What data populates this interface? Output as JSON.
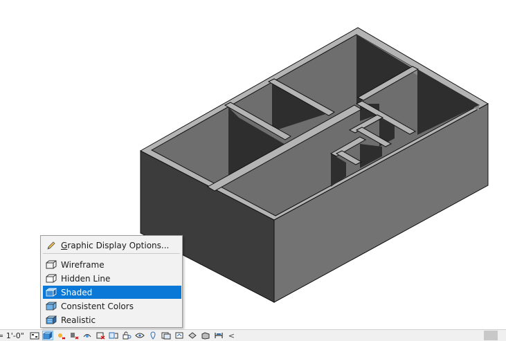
{
  "status_bar": {
    "scale_text": "= 1'-0\"",
    "icons": [
      "detail-level-icon",
      "visual-style-icon",
      "sun-path-icon",
      "shadows-icon",
      "show-rendering-icon",
      "crop-view-icon",
      "show-crop-icon",
      "unlock-3d-icon",
      "temporary-hide-icon",
      "reveal-hidden-icon",
      "worksharing-icon",
      "highlight-displacement-icon",
      "reveal-constraints-icon",
      "analytical-model-icon",
      "temp-view-icon"
    ],
    "overflow_symbol": "<"
  },
  "menu": {
    "graphic_display_options": {
      "accel": "G",
      "rest": "raphic Display Options..."
    },
    "items": [
      {
        "label": "Wireframe",
        "icon": "wireframe-icon",
        "selected": false
      },
      {
        "label": "Hidden Line",
        "icon": "hidden-line-icon",
        "selected": false
      },
      {
        "label": "Shaded",
        "icon": "shaded-icon",
        "selected": true
      },
      {
        "label": "Consistent Colors",
        "icon": "consistent-colors-icon",
        "selected": false
      },
      {
        "label": "Realistic",
        "icon": "realistic-icon",
        "selected": false
      }
    ]
  },
  "colors": {
    "selection": "#0a78d7",
    "wall_top": "#b4b4b4",
    "wall_dark": "#3c3c3c",
    "floor": "#6e6e6e"
  }
}
